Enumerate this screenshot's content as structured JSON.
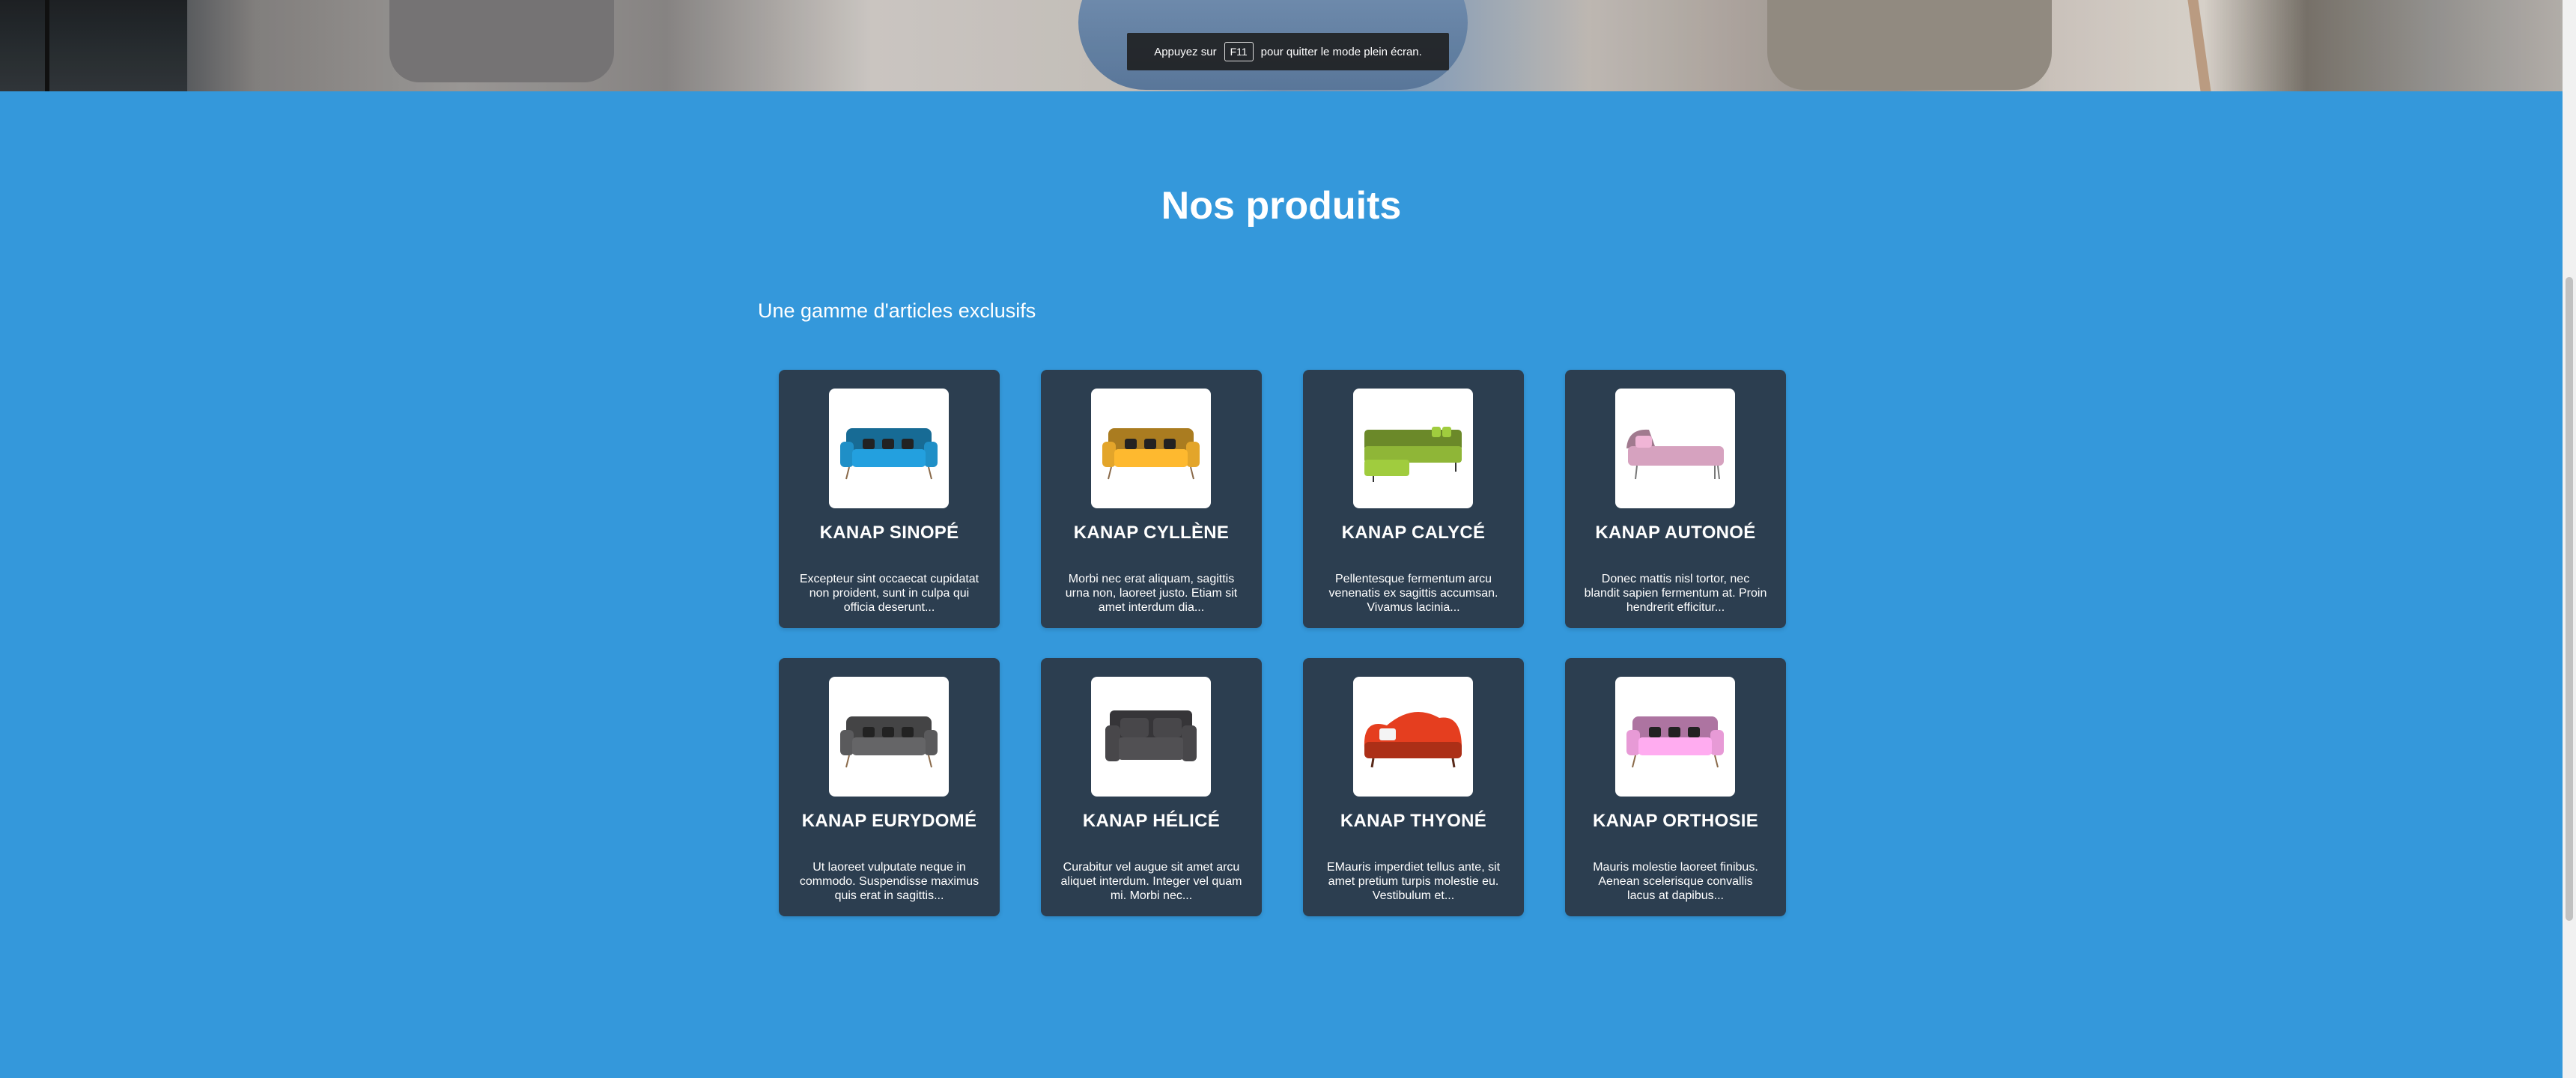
{
  "fullscreen_notice": {
    "before": "Appuyez sur",
    "key": "F11",
    "after": "pour quitter le mode plein écran."
  },
  "section": {
    "title": "Nos produits",
    "subtitle": "Une gamme d'articles exclusifs"
  },
  "products": [
    {
      "name": "KANAP SINOPÉ",
      "description": "Excepteur sint occaecat cupidatat non proident, sunt in culpa qui officia deserunt...",
      "color": "#1f8fc7",
      "type": "sofa"
    },
    {
      "name": "KANAP CYLLÈNE",
      "description": "Morbi nec erat aliquam, sagittis urna non, laoreet justo. Etiam sit amet interdum dia...",
      "color": "#e3a52a",
      "type": "sofa"
    },
    {
      "name": "KANAP CALYCÉ",
      "description": "Pellentesque fermentum arcu venenatis ex sagittis accumsan. Vivamus lacinia...",
      "color": "#8fb637",
      "type": "corner"
    },
    {
      "name": "KANAP AUTONOÉ",
      "description": "Donec mattis nisl tortor, nec blandit sapien fermentum at. Proin hendrerit efficitur...",
      "color": "#d6a2bf",
      "type": "chaise"
    },
    {
      "name": "KANAP EURYDOMÉ",
      "description": "Ut laoreet vulputate neque in commodo. Suspendisse maximus quis erat in sagittis...",
      "color": "#5a5a5c",
      "type": "sofa"
    },
    {
      "name": "KANAP HÉLICÉ",
      "description": "Curabitur vel augue sit amet arcu aliquet interdum. Integer vel quam mi. Morbi nec...",
      "color": "#48474a",
      "type": "loveseat"
    },
    {
      "name": "KANAP THYONÉ",
      "description": "EMauris imperdiet tellus ante, sit amet pretium turpis molestie eu. Vestibulum et...",
      "color": "#e53e1f",
      "type": "victorian"
    },
    {
      "name": "KANAP ORTHOSIE",
      "description": "Mauris molestie laoreet finibus. Aenean scelerisque convallis lacus at dapibus...",
      "color": "#e79ad6",
      "type": "sofa"
    }
  ]
}
